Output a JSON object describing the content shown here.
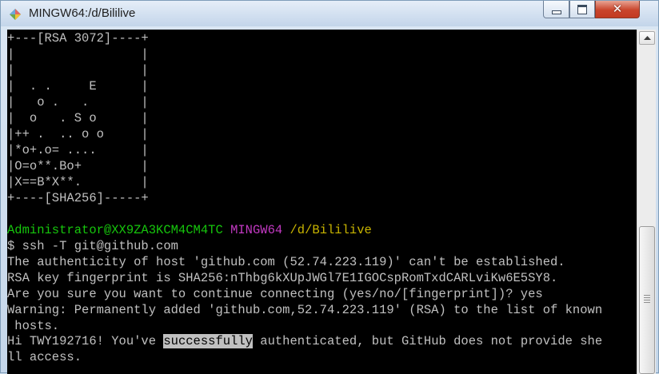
{
  "window": {
    "title": "MINGW64:/d/Bililive",
    "icon": "mingw-diamond-icon",
    "controls": {
      "minimize": "minimize-icon",
      "maximize": "maximize-icon",
      "close": "✕"
    }
  },
  "terminal": {
    "randomart": [
      "+---[RSA 3072]----+",
      "|                 |",
      "|                 |",
      "|  . .     E      |",
      "|   o .   .       |",
      "|  o   . S o      |",
      "|++ .  .. o o     |",
      "|*o+.o= ....      |",
      "|O=o**.Bo+        |",
      "|X==B*X**.        |",
      "+----[SHA256]-----+"
    ],
    "prompt": {
      "user_host": "Administrator@XX9ZA3KCM4CM4TC",
      "shell": "MINGW64",
      "cwd": "/d/Bililive"
    },
    "command": "$ ssh -T git@github.com",
    "output": [
      "The authenticity of host 'github.com (52.74.223.119)' can't be established.",
      "RSA key fingerprint is SHA256:nThbg6kXUpJWGl7E1IGOCspRomTxdCARLviKw6E5SY8.",
      "Are you sure you want to continue connecting (yes/no/[fingerprint])? yes",
      "Warning: Permanently added 'github.com,52.74.223.119' (RSA) to the list of known",
      " hosts."
    ],
    "final_line": {
      "before": "Hi TWY192716! You've ",
      "highlighted": "successfully",
      "after": " authenticated, but GitHub does not provide she"
    },
    "final_wrap": "ll access."
  },
  "colors": {
    "background": "#000000",
    "text": "#c0c0c0",
    "user_host": "#16c60c",
    "shell": "#c239c2",
    "cwd": "#c8b400"
  }
}
